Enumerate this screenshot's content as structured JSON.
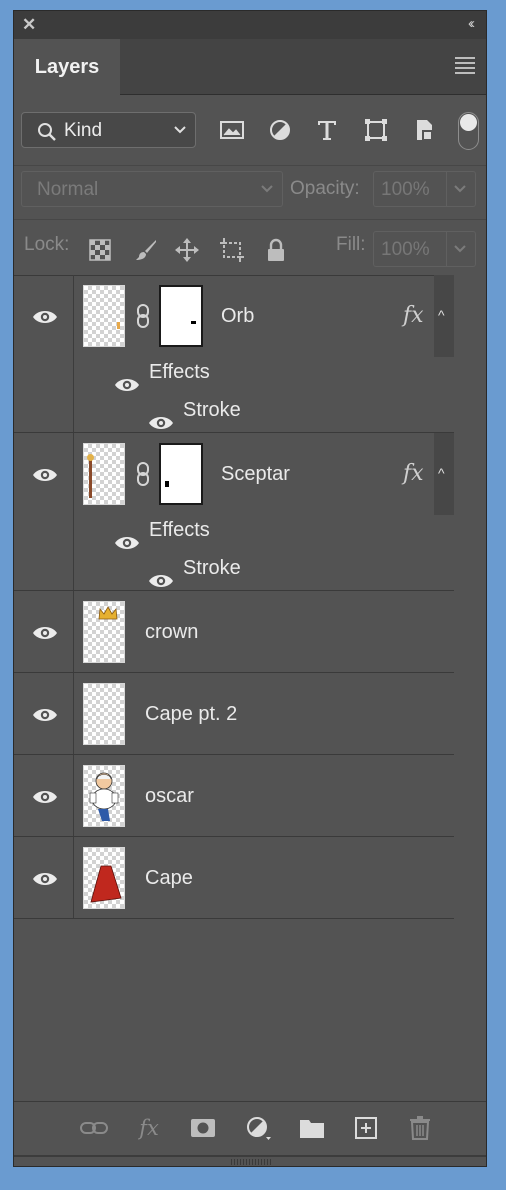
{
  "panel": {
    "tab_label": "Layers"
  },
  "filter": {
    "kind_label": "Kind"
  },
  "blend": {
    "mode": "Normal",
    "opacity_label": "Opacity:",
    "opacity_value": "100%"
  },
  "lock": {
    "label": "Lock:",
    "fill_label": "Fill:",
    "fill_value": "100%"
  },
  "layers": [
    {
      "name": "Orb",
      "effects_label": "Effects",
      "effect": "Stroke"
    },
    {
      "name": "Sceptar",
      "effects_label": "Effects",
      "effect": "Stroke"
    },
    {
      "name": "crown"
    },
    {
      "name": "Cape pt. 2"
    },
    {
      "name": "oscar"
    },
    {
      "name": "Cape"
    }
  ],
  "fx_label": "fx",
  "icons": [
    "close-icon",
    "collapse-icon",
    "panel-menu-icon",
    "search-icon",
    "image-filter-icon",
    "adjustment-filter-icon",
    "type-filter-icon",
    "shape-filter-icon",
    "smart-object-filter-icon",
    "filter-toggle",
    "eye-icon",
    "chain-link-icon",
    "checkerboard-lock-icon",
    "brush-lock-icon",
    "move-lock-icon",
    "artboard-lock-icon",
    "padlock-icon",
    "link-layers-icon",
    "add-style-icon",
    "add-mask-icon",
    "new-adjustment-icon",
    "new-group-icon",
    "new-layer-icon",
    "trash-icon"
  ]
}
